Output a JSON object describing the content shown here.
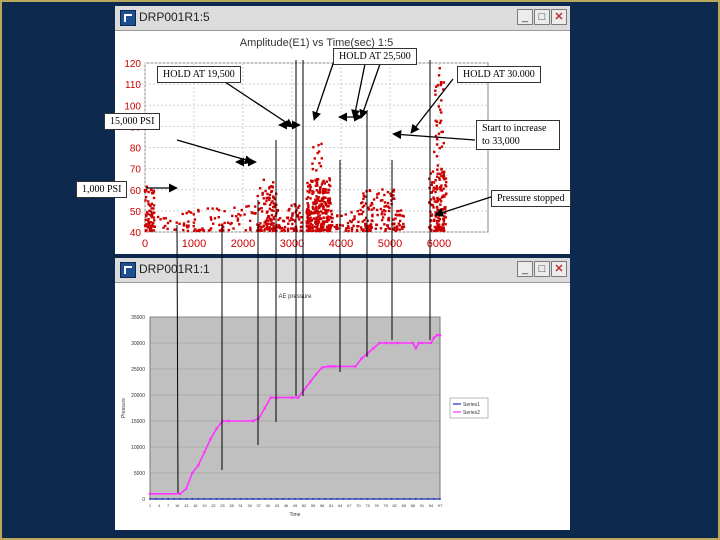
{
  "windows": {
    "top": {
      "title": "DRP001R1:5",
      "btn_min": "_",
      "btn_max": "□",
      "btn_close": "✕"
    },
    "bottom": {
      "title": "DRP001R1:1",
      "btn_min": "_",
      "btn_max": "□",
      "btn_close": "✕"
    }
  },
  "icons": {
    "app": "app-icon"
  },
  "callouts": {
    "hold_19500": "HOLD AT 19,500",
    "hold_25500": "HOLD AT 25,500",
    "hold_30000": "HOLD AT 30.000",
    "psi_15000": "15,000 PSI",
    "psi_1000": "1,000 PSI",
    "increase_33000": "Start to increase to 33,000",
    "pressure_stopped": "Pressure stopped"
  },
  "colors": {
    "amplitude_points": "#cc0000",
    "series1": "#1f2db0",
    "series2": "#ff33ff",
    "plot_bg": "#c0c0c0",
    "background": "#0d2a4e"
  },
  "chart_data": [
    {
      "type": "scatter",
      "title": "Amplitude(E1) vs Time(sec) 1:5",
      "xlabel": "",
      "ylabel": "",
      "x_ticks": [
        "0",
        "1000",
        "2000",
        "3000",
        "4000",
        "5000",
        "6000"
      ],
      "y_ticks": [
        "40",
        "50",
        "60",
        "70",
        "80",
        "90",
        "100",
        "110",
        "120"
      ],
      "xlim": [
        0,
        7000
      ],
      "ylim": [
        40,
        120
      ],
      "grid": true,
      "clusters": [
        {
          "x": [
            0,
            200
          ],
          "y_max": 62,
          "density": 70
        },
        {
          "x": [
            200,
            1100
          ],
          "y_max": 50,
          "density": 35
        },
        {
          "x": [
            1100,
            2300
          ],
          "y_max": 52,
          "density": 55
        },
        {
          "x": [
            2300,
            2700
          ],
          "y_max": 62,
          "density": 80
        },
        {
          "x": [
            2400,
            2650
          ],
          "y_max": 72,
          "density": 25
        },
        {
          "x": [
            2700,
            3200
          ],
          "y_max": 53,
          "density": 60
        },
        {
          "x": [
            3300,
            3800
          ],
          "y_max": 65,
          "density": 260
        },
        {
          "x": [
            3400,
            3650
          ],
          "y_max": 82,
          "density": 40
        },
        {
          "x": [
            3800,
            4400
          ],
          "y_max": 50,
          "density": 40
        },
        {
          "x": [
            4400,
            5100
          ],
          "y_max": 60,
          "density": 110
        },
        {
          "x": [
            5050,
            5300
          ],
          "y_max": 50,
          "density": 30
        },
        {
          "x": [
            5800,
            6150
          ],
          "y_max": 70,
          "density": 120
        },
        {
          "x": [
            5900,
            6100
          ],
          "y_max": 120,
          "density": 60
        }
      ]
    },
    {
      "type": "line",
      "title": "AE pressure",
      "xlabel": "Time",
      "ylabel": "Pressure",
      "x_ticks": [
        "1",
        "4",
        "7",
        "10",
        "13",
        "16",
        "19",
        "22",
        "25",
        "28",
        "31",
        "34",
        "37",
        "40",
        "43",
        "46",
        "49",
        "52",
        "55",
        "58",
        "61",
        "64",
        "67",
        "70",
        "73",
        "76",
        "79",
        "82",
        "85",
        "88",
        "91",
        "94",
        "97"
      ],
      "y_ticks": [
        "0",
        "5000",
        "10000",
        "15000",
        "20000",
        "25000",
        "30000",
        "35000"
      ],
      "xlim": [
        1,
        97
      ],
      "ylim": [
        0,
        35000
      ],
      "grid": true,
      "legend": "right",
      "series": [
        {
          "name": "Series1",
          "x": [
            1,
            97
          ],
          "y": [
            0,
            0
          ]
        },
        {
          "name": "Series2",
          "x": [
            1,
            11,
            13,
            15,
            17,
            19,
            21,
            23,
            25,
            27,
            35,
            37,
            39,
            41,
            43,
            48,
            50,
            52,
            54,
            56,
            58,
            60,
            61,
            62,
            64,
            69,
            71,
            73,
            75,
            77,
            79,
            81,
            83,
            88,
            89,
            90,
            91,
            94,
            95,
            96,
            97
          ],
          "y": [
            1000,
            1000,
            2000,
            5000,
            6500,
            9000,
            11500,
            13500,
            15000,
            15000,
            15000,
            15500,
            17500,
            19500,
            19500,
            19500,
            19500,
            21000,
            22500,
            24000,
            25300,
            25500,
            25500,
            25500,
            25500,
            25500,
            27000,
            28000,
            29000,
            30000,
            30000,
            30000,
            30000,
            30000,
            29000,
            30000,
            30000,
            30000,
            31000,
            31500,
            31500
          ]
        }
      ]
    }
  ]
}
